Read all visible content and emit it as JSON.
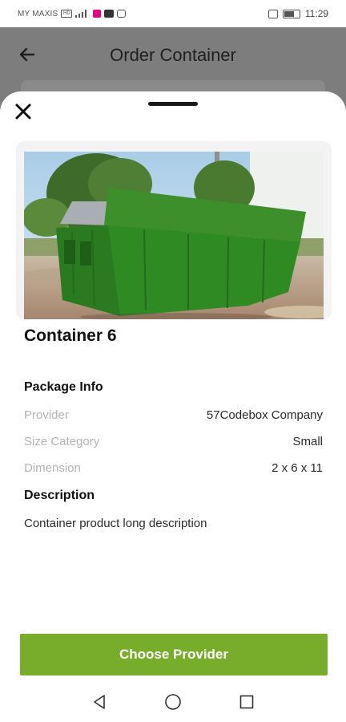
{
  "status_bar": {
    "carrier": "MY MAXIS",
    "network_badge": "HD",
    "time": "11:29",
    "icons": [
      "hd-icon",
      "signal-icon",
      "app-notification-icon",
      "youtube-icon",
      "photo-icon",
      "vibrate-icon",
      "battery-icon"
    ]
  },
  "header": {
    "title": "Order Container",
    "back_icon": "arrow-left-icon"
  },
  "sheet": {
    "close_icon": "close-icon",
    "product": {
      "image_alt": "green skip container",
      "carousel_count": 5,
      "carousel_active_index": 0,
      "title": "Container 6"
    },
    "package_info": {
      "title": "Package Info",
      "rows": [
        {
          "label": "Provider",
          "value": "57Codebox Company"
        },
        {
          "label": "Size Category",
          "value": "Small"
        },
        {
          "label": "Dimension",
          "value": "2 x 6 x 11"
        }
      ]
    },
    "description": {
      "title": "Description",
      "text": "Container product long description"
    },
    "cta": {
      "label": "Choose Provider",
      "color": "#77ad2b"
    }
  },
  "nav_bar": {
    "icons": [
      "back-triangle-icon",
      "home-circle-icon",
      "recents-square-icon"
    ]
  }
}
